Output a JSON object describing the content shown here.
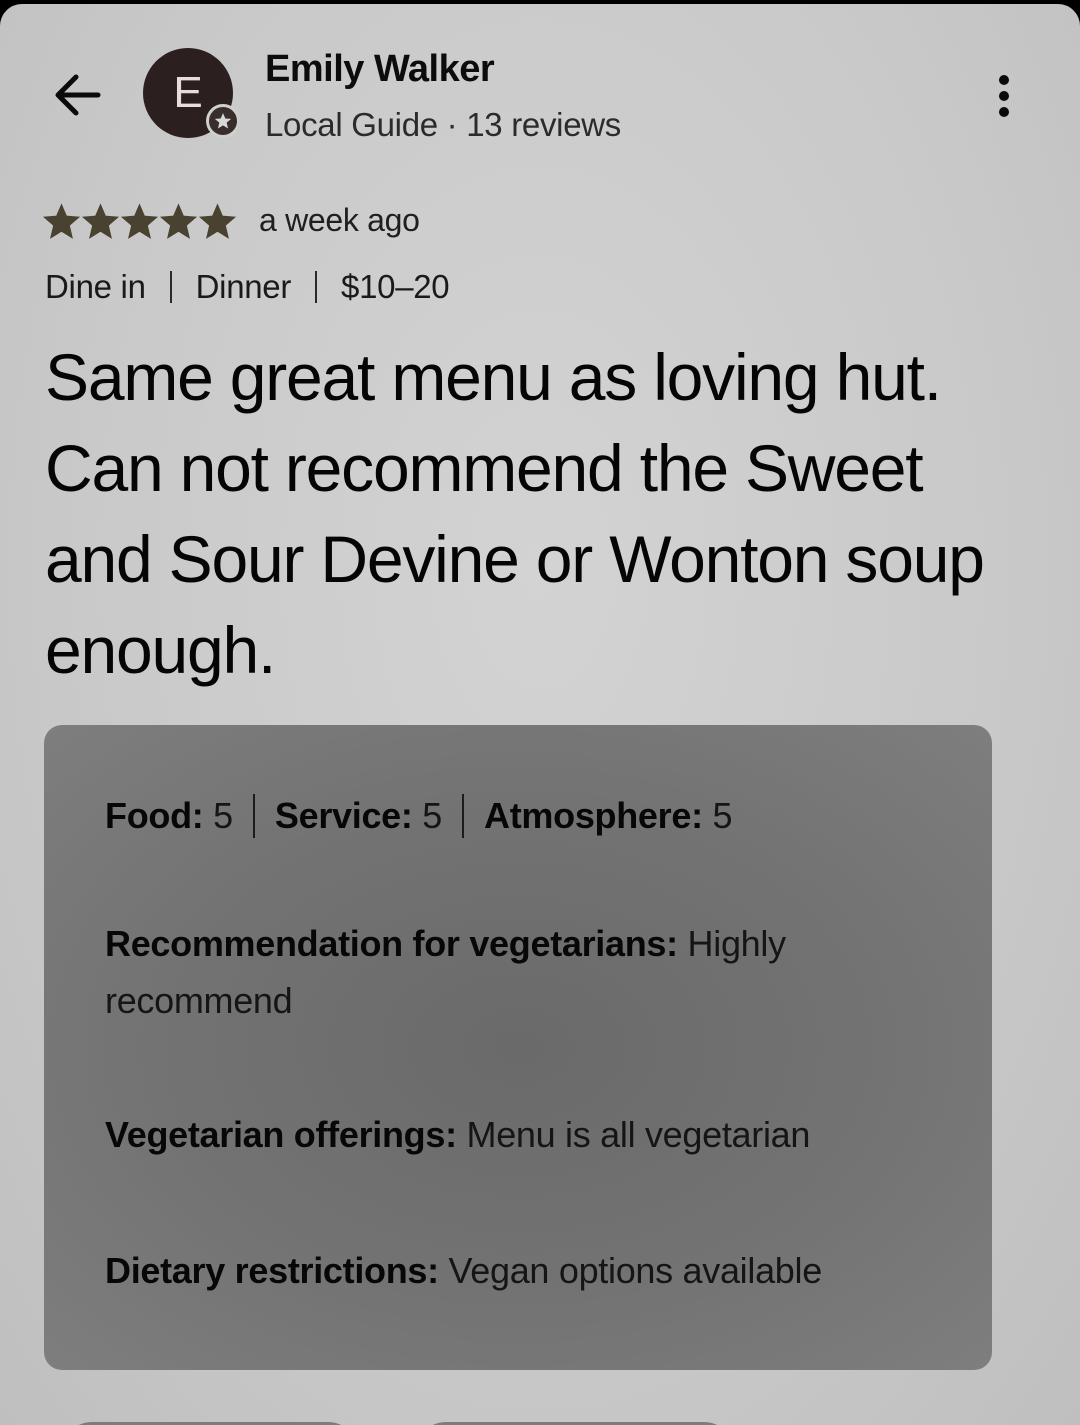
{
  "header": {
    "avatar_initial": "E",
    "user_name": "Emily Walker",
    "user_meta": "Local Guide · 13 reviews",
    "back_icon": "arrow-left-icon",
    "more_icon": "more-vert-icon",
    "badge_icon": "star-badge-icon",
    "avatar_color": "#2c1f1f"
  },
  "rating": {
    "stars": 5,
    "max_stars": 5,
    "star_color": "#4a4230",
    "time": "a week ago"
  },
  "visit": {
    "mode": "Dine in",
    "meal": "Dinner",
    "price": "$10–20"
  },
  "review": {
    "text": "Same great menu as loving hut. Can not recommend the Sweet and Sour Devine or Wonton soup enough."
  },
  "details": {
    "scores": [
      {
        "label": "Food:",
        "value": "5"
      },
      {
        "label": "Service:",
        "value": "5"
      },
      {
        "label": "Atmosphere:",
        "value": "5"
      }
    ],
    "vegetarian_recommendation": {
      "label": "Recommendation for vegetarians:",
      "value": "Highly recommend"
    },
    "vegetarian_offerings": {
      "label": "Vegetarian offerings:",
      "value": "Menu is all vegetarian"
    },
    "dietary_restrictions": {
      "label": "Dietary restrictions:",
      "value": "Vegan options available"
    }
  }
}
